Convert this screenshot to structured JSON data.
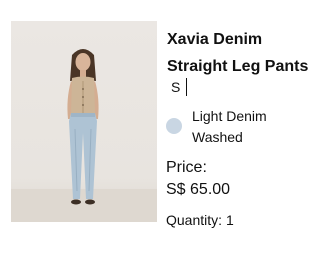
{
  "product": {
    "title": "Xavia Denim Straight Leg Pants",
    "size": "S",
    "color_name": "Light Denim Washed",
    "color_swatch": "#c9d6e3",
    "image_alt": "Model wearing Xavia Denim Straight Leg Pants"
  },
  "pricing": {
    "price_label": "Price:",
    "price_value": "S$ 65.00"
  },
  "quantity": {
    "label": "Quantity:",
    "value": "1"
  }
}
